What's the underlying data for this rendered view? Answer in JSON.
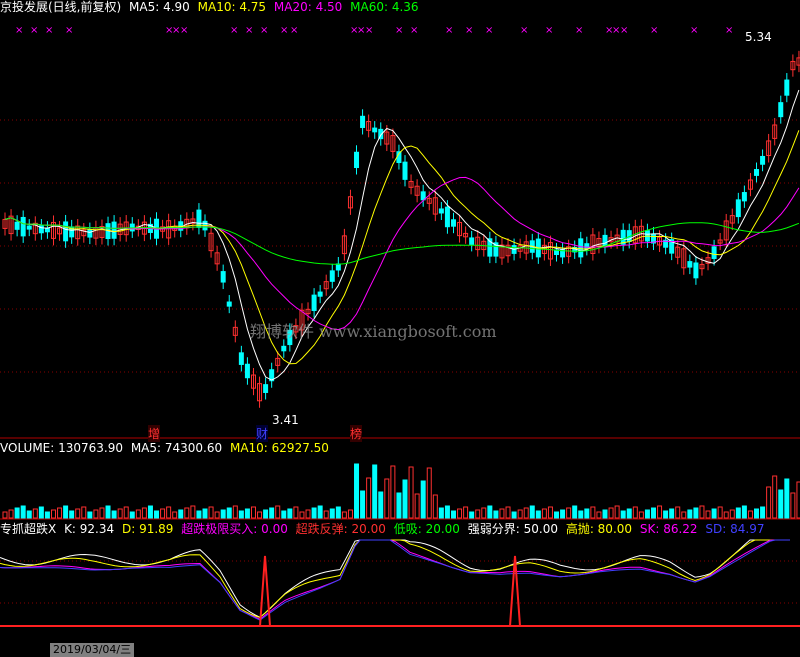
{
  "main_header": {
    "title": "京投发展(日线,前复权)",
    "ma": [
      {
        "label": "MA5: 4.90",
        "color": "#ffffff"
      },
      {
        "label": "MA10: 4.75",
        "color": "#ffff00"
      },
      {
        "label": "MA20: 4.50",
        "color": "#ff00ff"
      },
      {
        "label": "MA60: 4.36",
        "color": "#00ff00"
      }
    ]
  },
  "price_labels": {
    "high": "5.34",
    "low": "3.41"
  },
  "event_markers": [
    {
      "text": "增"
    },
    {
      "text": "财"
    },
    {
      "text": "榜"
    }
  ],
  "watermark": "翔博软件 www.xiangbosoft.com",
  "volume_header": {
    "title": "VOLUME: 130763.90",
    "ma5": "MA5: 74300.60",
    "ma10": "MA10: 62927.50"
  },
  "indicator_header": [
    {
      "text": "专抓超跌X",
      "color": "#ffffff"
    },
    {
      "text": "K: 92.34",
      "color": "#ffffff"
    },
    {
      "text": "D: 91.89",
      "color": "#ffff00"
    },
    {
      "text": "超跌极限买入: 0.00",
      "color": "#ff00ff"
    },
    {
      "text": "超跌反弹: 20.00",
      "color": "#ff3030"
    },
    {
      "text": "低吸: 20.00",
      "color": "#00ff00"
    },
    {
      "text": "强弱分界: 50.00",
      "color": "#ffffff"
    },
    {
      "text": "高抛: 80.00",
      "color": "#ffff00"
    },
    {
      "text": "SK: 86.22",
      "color": "#ff00ff"
    },
    {
      "text": "SD: 84.97",
      "color": "#4040ff"
    }
  ],
  "bottom_axis": "2019/03/04/三",
  "colors": {
    "up": "#ff3030",
    "down": "#00ffff",
    "ma5": "#ffffff",
    "ma10": "#ffff00",
    "ma20": "#ff00ff",
    "ma60": "#00ff00",
    "grid": "#880000",
    "magenta": "#ff00ff"
  }
}
